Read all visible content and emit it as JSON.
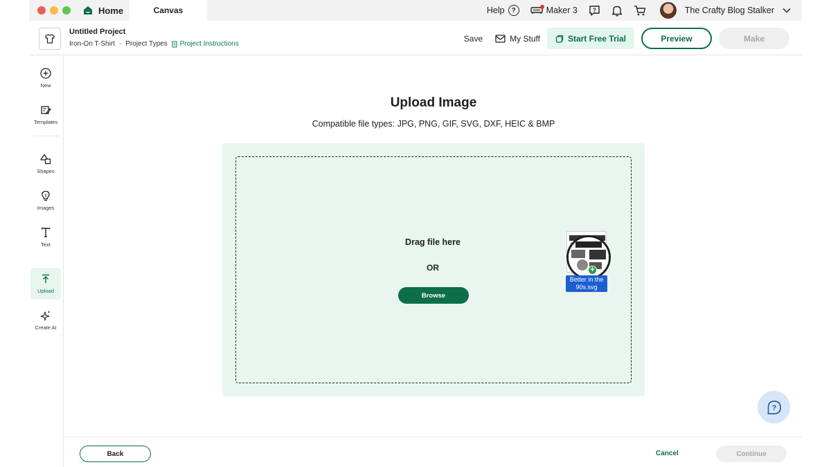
{
  "titlebar": {
    "home_label": "Home",
    "canvas_tab": "Canvas",
    "help_label": "Help",
    "machine_label": "Maker 3",
    "user_name": "The Crafty Blog Stalker"
  },
  "project": {
    "title": "Untitled Project",
    "type": "Iron-On T-Shirt",
    "separator": "·",
    "project_types": "Project Types",
    "instructions": "Project Instructions"
  },
  "actions": {
    "save": "Save",
    "my_stuff": "My Stuff",
    "trial": "Start Free Trial",
    "preview": "Preview",
    "make": "Make"
  },
  "sidebar": {
    "items": [
      {
        "label": "New",
        "icon": "plus-circle-icon"
      },
      {
        "label": "Templates",
        "icon": "templates-icon"
      },
      {
        "label": "Shapes",
        "icon": "shapes-icon"
      },
      {
        "label": "Images",
        "icon": "lightbulb-icon"
      },
      {
        "label": "Text",
        "icon": "text-icon"
      },
      {
        "label": "Upload",
        "icon": "upload-icon"
      },
      {
        "label": "Create AI",
        "icon": "sparkle-icon"
      }
    ]
  },
  "upload": {
    "title": "Upload Image",
    "subtitle": "Compatible file types:  JPG, PNG, GIF, SVG, DXF, HEIC & BMP",
    "drag": "Drag file here",
    "or": "OR",
    "browse": "Browse",
    "file_name": "Better in the 90s.svg"
  },
  "footer": {
    "back": "Back",
    "cancel": "Cancel",
    "continue": "Continue"
  },
  "colors": {
    "accent": "#0d6e47",
    "drop_bg": "#e8f6ef",
    "trial_bg": "#e3f6ee",
    "disabled_bg": "#efefef",
    "help_fab": "#d6e5f8"
  }
}
